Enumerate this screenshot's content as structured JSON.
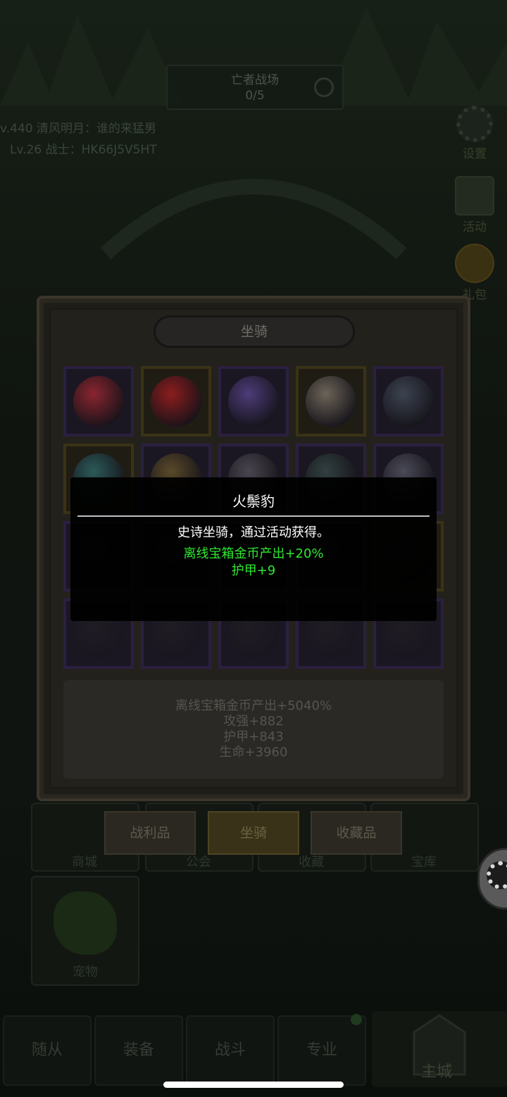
{
  "background": {
    "battlefield": {
      "title": "亡者战场",
      "progress": "0/5"
    },
    "chat": [
      "v.440 清风明月：谁的来猛男",
      "Lv.26 战士：HK66J5V5HT"
    ],
    "side_buttons": [
      {
        "icon": "gear-icon",
        "label": "设置"
      },
      {
        "icon": "calendar-icon",
        "label": "活动"
      },
      {
        "icon": "coin-icon",
        "label": "礼包"
      }
    ],
    "grid_buttons": [
      "商城",
      "公会",
      "收藏",
      "宝库"
    ],
    "pet_label": "宠物",
    "bottom_nav": [
      "随从",
      "装备",
      "战斗",
      "专业",
      "主城"
    ]
  },
  "panel": {
    "title": "坐骑",
    "stats": [
      "离线宝箱金币产出+5040%",
      "攻强+882",
      "护甲+843",
      "生命+3960"
    ],
    "tabs": [
      "战利品",
      "坐骑",
      "收藏品"
    ],
    "active_tab": "坐骑",
    "slots": [
      {
        "name": "mount-helm-red",
        "frame": "purple",
        "color": "#8a2530"
      },
      {
        "name": "mount-armor-crimson",
        "frame": "gold",
        "color": "#8c1d1d"
      },
      {
        "name": "mount-knight-violet",
        "frame": "purple",
        "color": "#4d3c78"
      },
      {
        "name": "mount-beast-bone",
        "frame": "gold",
        "color": "#6c6458"
      },
      {
        "name": "mount-mech-steel",
        "frame": "purple",
        "color": "#3c4350"
      },
      {
        "name": "mount-orb-teal",
        "frame": "gold",
        "color": "#2c5a58"
      },
      {
        "name": "mount-crest-gold",
        "frame": "purple",
        "color": "#5a4a2a"
      },
      {
        "name": "mount-swirl-gray",
        "frame": "purple",
        "color": "#4a4650"
      },
      {
        "name": "mount-dragon-green",
        "frame": "purple",
        "color": "#314040"
      },
      {
        "name": "mount-spirit-silver",
        "frame": "purple",
        "color": "#4a4a58"
      },
      {
        "name": "mount-shadow-1",
        "frame": "purple",
        "color": "#2a2a30"
      },
      {
        "name": "mount-shadow-2",
        "frame": "purple",
        "color": "#2a2a30"
      },
      {
        "name": "mount-shadow-3",
        "frame": "purple",
        "color": "#2a2a30"
      },
      {
        "name": "mount-shadow-4",
        "frame": "purple",
        "color": "#2a2a30"
      },
      {
        "name": "mount-shadow-5",
        "frame": "gold",
        "color": "#2a2a30"
      },
      {
        "name": "mount-shadow-6",
        "frame": "purple",
        "color": "#262628"
      },
      {
        "name": "mount-shadow-7",
        "frame": "purple",
        "color": "#262628"
      },
      {
        "name": "mount-shadow-8",
        "frame": "purple",
        "color": "#262628"
      },
      {
        "name": "mount-shadow-9",
        "frame": "purple",
        "color": "#262628"
      },
      {
        "name": "mount-shadow-10",
        "frame": "purple",
        "color": "#262628"
      }
    ]
  },
  "tooltip": {
    "name": "火鬃豹",
    "description": "史诗坐骑，通过活动获得。",
    "bonuses": [
      "离线宝箱金币产出+20%",
      "护甲+9"
    ],
    "bonus_color": "#2fe92f"
  }
}
